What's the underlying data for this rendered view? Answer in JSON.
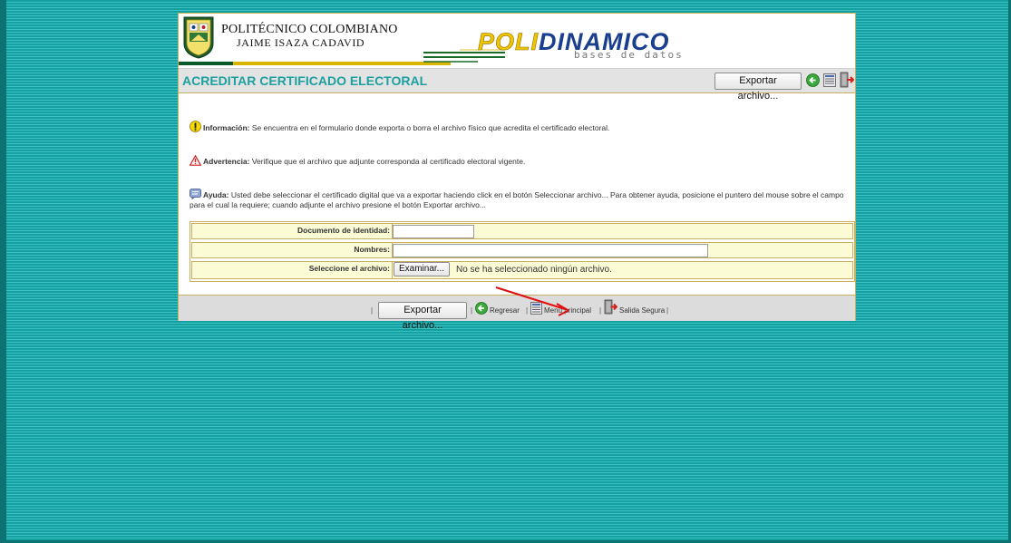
{
  "header": {
    "institution_name": "POLITÉCNICO COLOMBIANO",
    "institution_subname": "JAIME ISAZA CADAVID",
    "logo_part_a": "POLI",
    "logo_part_b": "DINAMICO",
    "logo_tagline": "bases de datos"
  },
  "titlebar": {
    "title": "ACREDITAR CERTIFICADO ELECTORAL",
    "export_label": "Exportar archivo..."
  },
  "messages": {
    "info_label": "Información:",
    "info_text": " Se encuentra en el formulario donde exporta o borra el archivo físico que acredita el certificado electoral.",
    "warning_label": "Advertencia:",
    "warning_text": " Verifique que el archivo que adjunte corresponda al certificado electoral vigente.",
    "help_label": "Ayuda:",
    "help_text": " Usted debe seleccionar el certificado digital que va a exportar haciendo click en el botón Seleccionar archivo... Para obtener ayuda, posicione el puntero del mouse sobre el campo para el cual la requiere; cuando adjunte el archivo presione el botón Exportar archivo..."
  },
  "form": {
    "document_label": "Documento de identidad:",
    "document_value": "",
    "names_label": "Nombres:",
    "names_value": "",
    "file_label": "Seleccione el archivo:",
    "browse_label": "Examinar...",
    "file_status": "No se ha seleccionado ningún archivo."
  },
  "footer": {
    "separator": "|",
    "export_label": "Exportar archivo...",
    "back_label": "Regresar",
    "menu_label": "Menú principal",
    "exit_label": "Salida Segura"
  },
  "colors": {
    "accent": "#1e9fa0",
    "border": "#c8b060",
    "row_bg": "#fbfbd6",
    "background": "#1aa5a5"
  }
}
